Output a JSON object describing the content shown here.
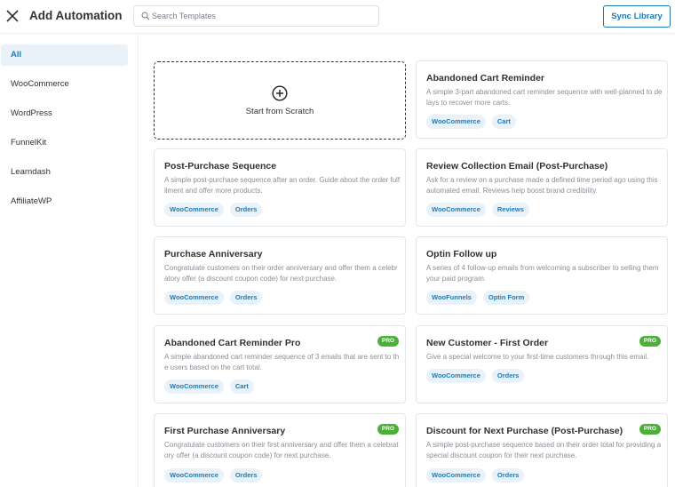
{
  "header": {
    "title": "Add Automation",
    "search_placeholder": "Search Templates",
    "sync_label": "Sync Library"
  },
  "sidebar": {
    "items": [
      {
        "label": "All",
        "active": true
      },
      {
        "label": "WooCommerce",
        "active": false
      },
      {
        "label": "WordPress",
        "active": false
      },
      {
        "label": "FunnelKit",
        "active": false
      },
      {
        "label": "Learndash",
        "active": false
      },
      {
        "label": "AffiliateWP",
        "active": false
      }
    ]
  },
  "scratch": {
    "label": "Start from Scratch",
    "icon": "plus-circle-icon"
  },
  "colors": {
    "accent": "#1f7ab4",
    "pro": "#4caf3a",
    "tag_bg": "#eaf2f9"
  },
  "templates": [
    {
      "title": "Abandoned Cart Reminder",
      "description": "A simple 3-part abandoned cart reminder sequence with well-planned to delays to recover more carts.",
      "tags": [
        "WooCommerce",
        "Cart"
      ],
      "pro": false
    },
    {
      "title": "Post-Purchase Sequence",
      "description": "A simple post-purchase sequence after an order. Guide about the order fulfilment and offer more products.",
      "tags": [
        "WooCommerce",
        "Orders"
      ],
      "pro": false
    },
    {
      "title": "Review Collection Email (Post-Purchase)",
      "description": "Ask for a review on a purchase made a defined time period ago using this automated email. Reviews help boost brand credibility.",
      "tags": [
        "WooCommerce",
        "Reviews"
      ],
      "pro": false
    },
    {
      "title": "Purchase Anniversary",
      "description": "Congratulate customers on their order anniversary and offer them a celebratory offer (a discount coupon code) for next purchase.",
      "tags": [
        "WooCommerce",
        "Orders"
      ],
      "pro": false
    },
    {
      "title": "Optin Follow up",
      "description": "A series of 4 follow-up emails from welcoming a subscriber to selling them your paid program.",
      "tags": [
        "WooFunnels",
        "Optin Form"
      ],
      "pro": false
    },
    {
      "title": "Abandoned Cart Reminder Pro",
      "description": "A simple abandoned cart reminder sequence of 3 emails that are sent to the users based on the cart total.",
      "tags": [
        "WooCommerce",
        "Cart"
      ],
      "pro": true
    },
    {
      "title": "New Customer - First Order",
      "description": "Give a special welcome to your first-time customers through this email.",
      "tags": [
        "WooCommerce",
        "Orders"
      ],
      "pro": true
    },
    {
      "title": "First Purchase Anniversary",
      "description": "Congratulate customers on their first anniversary and offer them a celebratory offer (a discount coupon code) for next purchase.",
      "tags": [
        "WooCommerce",
        "Orders"
      ],
      "pro": true
    },
    {
      "title": "Discount for Next Purchase (Post-Purchase)",
      "description": "A simple post-purchase sequence based on their order total for providing a special discount coupon for their next purchase.",
      "tags": [
        "WooCommerce",
        "Orders"
      ],
      "pro": true
    }
  ],
  "pro_label": "PRO"
}
